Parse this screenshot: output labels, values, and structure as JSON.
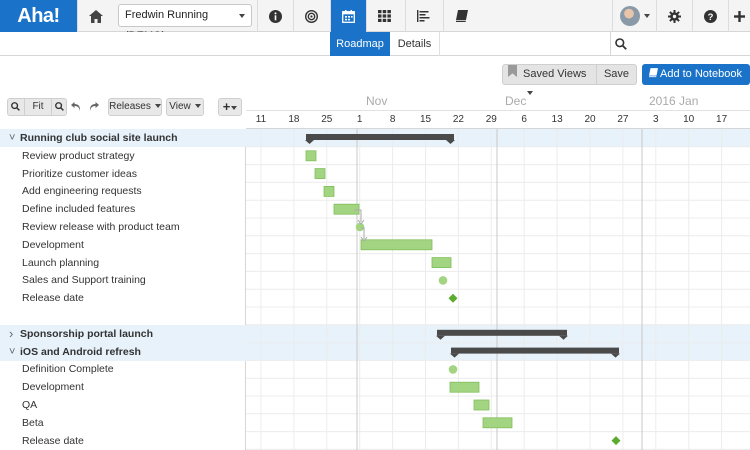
{
  "app": {
    "logo": "Aha!",
    "workspace": "Fredwin Running (DEMO)"
  },
  "topbar": {
    "icons": [
      "home-icon",
      "info-icon",
      "target-icon",
      "calendar-icon",
      "grid-icon",
      "list-icon",
      "notebook-icon",
      "gear-icon",
      "help-icon",
      "plus-icon"
    ]
  },
  "tabs": [
    {
      "label": "Roadmap",
      "active": true
    },
    {
      "label": "Details",
      "active": false
    }
  ],
  "actions": {
    "saved_views": "Saved Views",
    "save": "Save",
    "add_to_notebook": "Add to Notebook"
  },
  "toolbar": {
    "fit": "Fit",
    "releases": "Releases",
    "view": "View"
  },
  "timeline": {
    "months": [
      "Nov",
      "Dec",
      "2016 Jan"
    ],
    "weeks": [
      "11",
      "18",
      "25",
      "1",
      "8",
      "15",
      "22",
      "29",
      "6",
      "13",
      "20",
      "27",
      "3",
      "10",
      "17"
    ]
  },
  "rows": [
    {
      "label": "Running club social site launch",
      "type": "group",
      "expanded": true
    },
    {
      "label": "Review product strategy",
      "type": "item"
    },
    {
      "label": "Prioritize customer ideas",
      "type": "item"
    },
    {
      "label": "Add engineering requests",
      "type": "item"
    },
    {
      "label": "Define included features",
      "type": "item"
    },
    {
      "label": "Review release with product team",
      "type": "item"
    },
    {
      "label": "Development",
      "type": "item"
    },
    {
      "label": "Launch planning",
      "type": "item"
    },
    {
      "label": "Sales and Support training",
      "type": "item"
    },
    {
      "label": "Release date",
      "type": "item"
    },
    {
      "label": "",
      "type": "blank"
    },
    {
      "label": "Sponsorship portal launch",
      "type": "group",
      "expanded": false
    },
    {
      "label": "iOS and Android refresh",
      "type": "group",
      "expanded": true
    },
    {
      "label": "Definition Complete",
      "type": "item"
    },
    {
      "label": "Development",
      "type": "item"
    },
    {
      "label": "QA",
      "type": "item"
    },
    {
      "label": "Beta",
      "type": "item"
    },
    {
      "label": "Release date",
      "type": "item"
    }
  ],
  "colors": {
    "brand": "#1a73c8",
    "group_row": "#e7f2fb",
    "bar_fill": "#a3d482",
    "bar_stroke": "#7fbf5a",
    "milestone": "#5aab2e",
    "summary_bar": "#4a4a4a"
  }
}
